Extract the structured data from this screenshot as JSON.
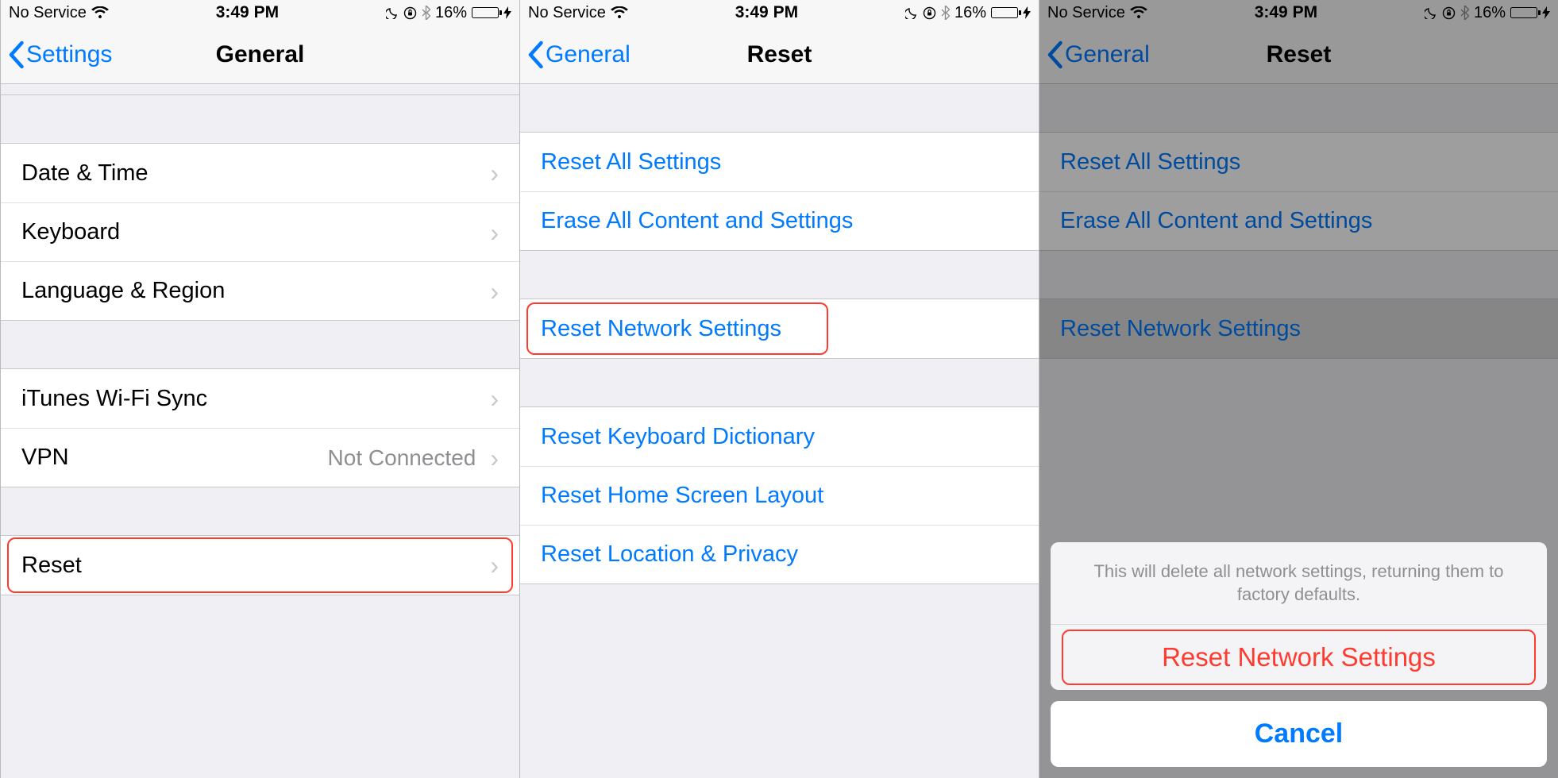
{
  "status": {
    "carrier": "No Service",
    "time": "3:49 PM",
    "battery_pct": "16%"
  },
  "screen1": {
    "back": "Settings",
    "title": "General",
    "rows": {
      "date_time": "Date & Time",
      "keyboard": "Keyboard",
      "language_region": "Language & Region",
      "itunes_wifi_sync": "iTunes Wi-Fi Sync",
      "vpn": "VPN",
      "vpn_status": "Not Connected",
      "reset": "Reset"
    }
  },
  "screen2": {
    "back": "General",
    "title": "Reset",
    "rows": {
      "reset_all": "Reset All Settings",
      "erase_all": "Erase All Content and Settings",
      "reset_network": "Reset Network Settings",
      "reset_keyboard": "Reset Keyboard Dictionary",
      "reset_home": "Reset Home Screen Layout",
      "reset_location": "Reset Location & Privacy"
    }
  },
  "screen3": {
    "back": "General",
    "title": "Reset",
    "rows": {
      "reset_all": "Reset All Settings",
      "erase_all": "Erase All Content and Settings",
      "reset_network": "Reset Network Settings"
    },
    "sheet": {
      "message": "This will delete all network settings, returning them to factory defaults.",
      "destructive": "Reset Network Settings",
      "cancel": "Cancel"
    }
  }
}
